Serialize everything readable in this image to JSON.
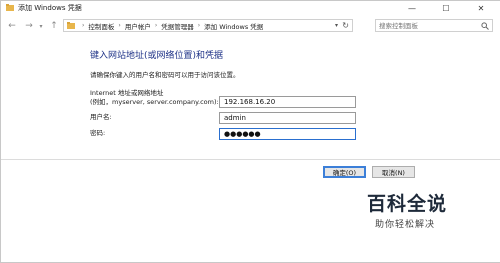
{
  "window": {
    "title": "添加 Windows 凭据"
  },
  "titlebar_controls": {
    "minimize": "—",
    "maximize": "☐",
    "close": "✕"
  },
  "nav": {
    "back_icon": "arrow-left-icon",
    "forward_icon": "arrow-right-icon",
    "recent_icon": "chevron-down-icon",
    "up_icon": "arrow-up-icon",
    "breadcrumbs": [
      "控制面板",
      "用户帐户",
      "凭据管理器",
      "添加 Windows 凭据"
    ],
    "breadcrumb_separator": "›",
    "search_placeholder": "搜索控制面板"
  },
  "form": {
    "heading": "键入网站地址(或网络位置)和凭据",
    "subtext": "请确保你键入的用户名和密码可以用于访问该位置。",
    "address_label_line1": "Internet 地址或网络地址",
    "address_label_line2": "(例如，myserver, server.company.com):",
    "address_value": "192.168.16.20",
    "username_label": "用户名:",
    "username_value": "admin",
    "password_label": "密码:",
    "password_value": "●●●●●●"
  },
  "buttons": {
    "ok": "确定(O)",
    "cancel": "取消(N)"
  },
  "watermark": {
    "logo_text": "百科全说",
    "slogan": "助你轻松解决"
  },
  "colors": {
    "heading": "#1e3287",
    "focus": "#2a6fcf",
    "folder": "#e8b64c"
  }
}
